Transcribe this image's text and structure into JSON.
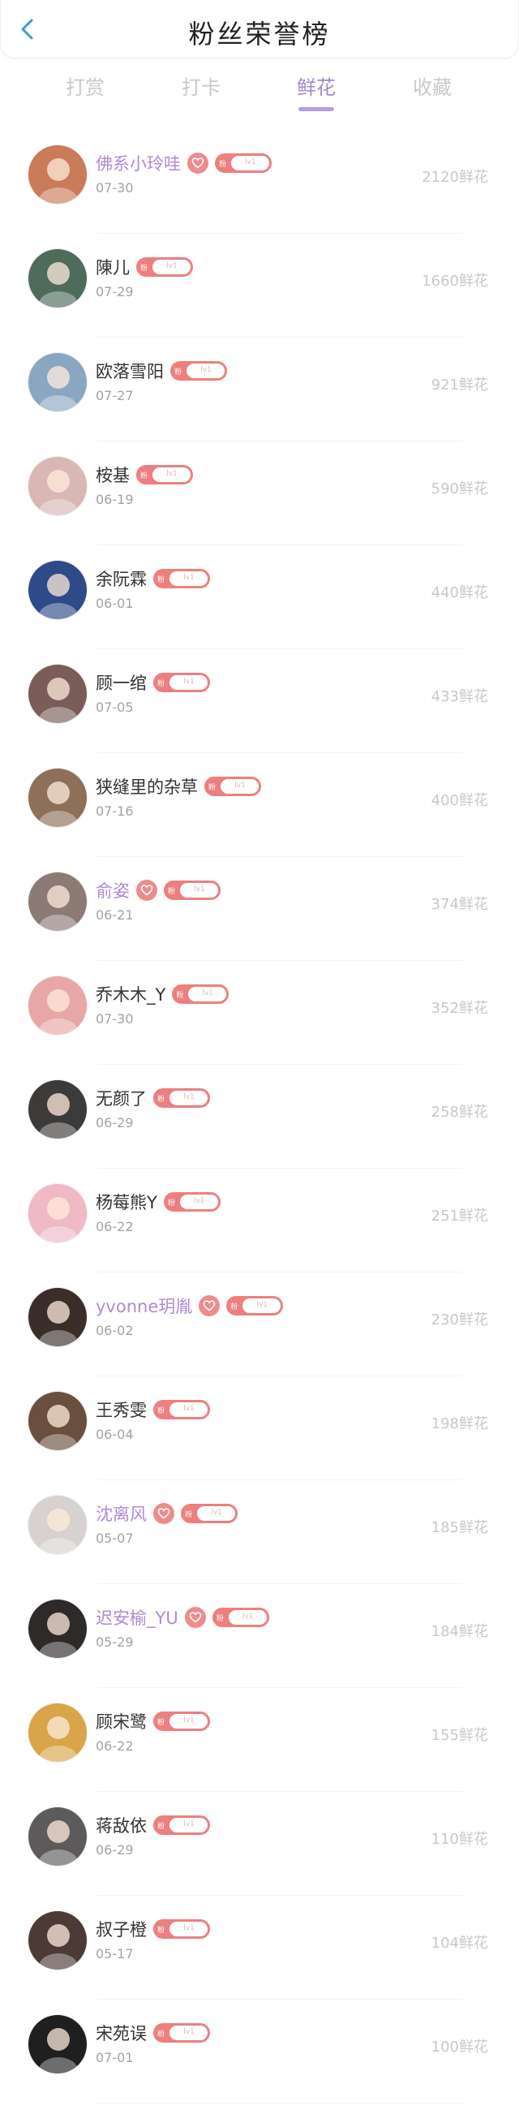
{
  "header": {
    "title": "粉丝荣誉榜"
  },
  "tabs": [
    {
      "label": "打赏",
      "active": false
    },
    {
      "label": "打卡",
      "active": false
    },
    {
      "label": "鲜花",
      "active": true
    },
    {
      "label": "收藏",
      "active": false
    }
  ],
  "colors": {
    "accent": "#a288d8",
    "vip_name": "#b08ad6",
    "badge": "#ed7f7f",
    "muted": "#c9c9c9"
  },
  "badge_text": {
    "dot": "粉",
    "level": "lv1"
  },
  "fans": [
    {
      "name": "佛系小玲哇",
      "date": "07-30",
      "amount": "2120鲜花",
      "vip": true,
      "avatar_color": "#c97b5a"
    },
    {
      "name": "陳儿",
      "date": "07-29",
      "amount": "1660鲜花",
      "vip": false,
      "avatar_color": "#4e6b5c"
    },
    {
      "name": "欧落雪阳",
      "date": "07-27",
      "amount": "921鲜花",
      "vip": false,
      "avatar_color": "#8aa6c1"
    },
    {
      "name": "桉基",
      "date": "06-19",
      "amount": "590鲜花",
      "vip": false,
      "avatar_color": "#d9b7b5"
    },
    {
      "name": "余阮霖",
      "date": "06-01",
      "amount": "440鲜花",
      "vip": false,
      "avatar_color": "#2f4a88"
    },
    {
      "name": "顾一绾",
      "date": "07-05",
      "amount": "433鲜花",
      "vip": false,
      "avatar_color": "#7a5c58"
    },
    {
      "name": "狭缝里的杂草",
      "date": "07-16",
      "amount": "400鲜花",
      "vip": false,
      "avatar_color": "#8d6f5a"
    },
    {
      "name": "俞姿",
      "date": "06-21",
      "amount": "374鲜花",
      "vip": true,
      "avatar_color": "#8c7a75"
    },
    {
      "name": "乔木木_Y",
      "date": "07-30",
      "amount": "352鲜花",
      "vip": false,
      "avatar_color": "#e8a7a7"
    },
    {
      "name": "无颜了",
      "date": "06-29",
      "amount": "258鲜花",
      "vip": false,
      "avatar_color": "#3d3b3a"
    },
    {
      "name": "杨莓熊Y",
      "date": "06-22",
      "amount": "251鲜花",
      "vip": false,
      "avatar_color": "#efb9c6"
    },
    {
      "name": "yvonne玥胤",
      "date": "06-02",
      "amount": "230鲜花",
      "vip": true,
      "avatar_color": "#3b2e2a"
    },
    {
      "name": "王秀雯",
      "date": "06-04",
      "amount": "198鲜花",
      "vip": false,
      "avatar_color": "#6b4f3e"
    },
    {
      "name": "沈离风",
      "date": "05-07",
      "amount": "185鲜花",
      "vip": true,
      "avatar_color": "#d7d2cf"
    },
    {
      "name": "迟安榆_YU",
      "date": "05-29",
      "amount": "184鲜花",
      "vip": true,
      "avatar_color": "#2e2a29"
    },
    {
      "name": "顾宋鹭",
      "date": "06-22",
      "amount": "155鲜花",
      "vip": false,
      "avatar_color": "#d9a54a"
    },
    {
      "name": "蒋敌依",
      "date": "06-29",
      "amount": "110鲜花",
      "vip": false,
      "avatar_color": "#5c5a5a"
    },
    {
      "name": "叔子橙",
      "date": "05-17",
      "amount": "104鲜花",
      "vip": false,
      "avatar_color": "#4b3a35"
    },
    {
      "name": "宋苑误",
      "date": "07-01",
      "amount": "100鲜花",
      "vip": false,
      "avatar_color": "#1f1f1f"
    }
  ]
}
